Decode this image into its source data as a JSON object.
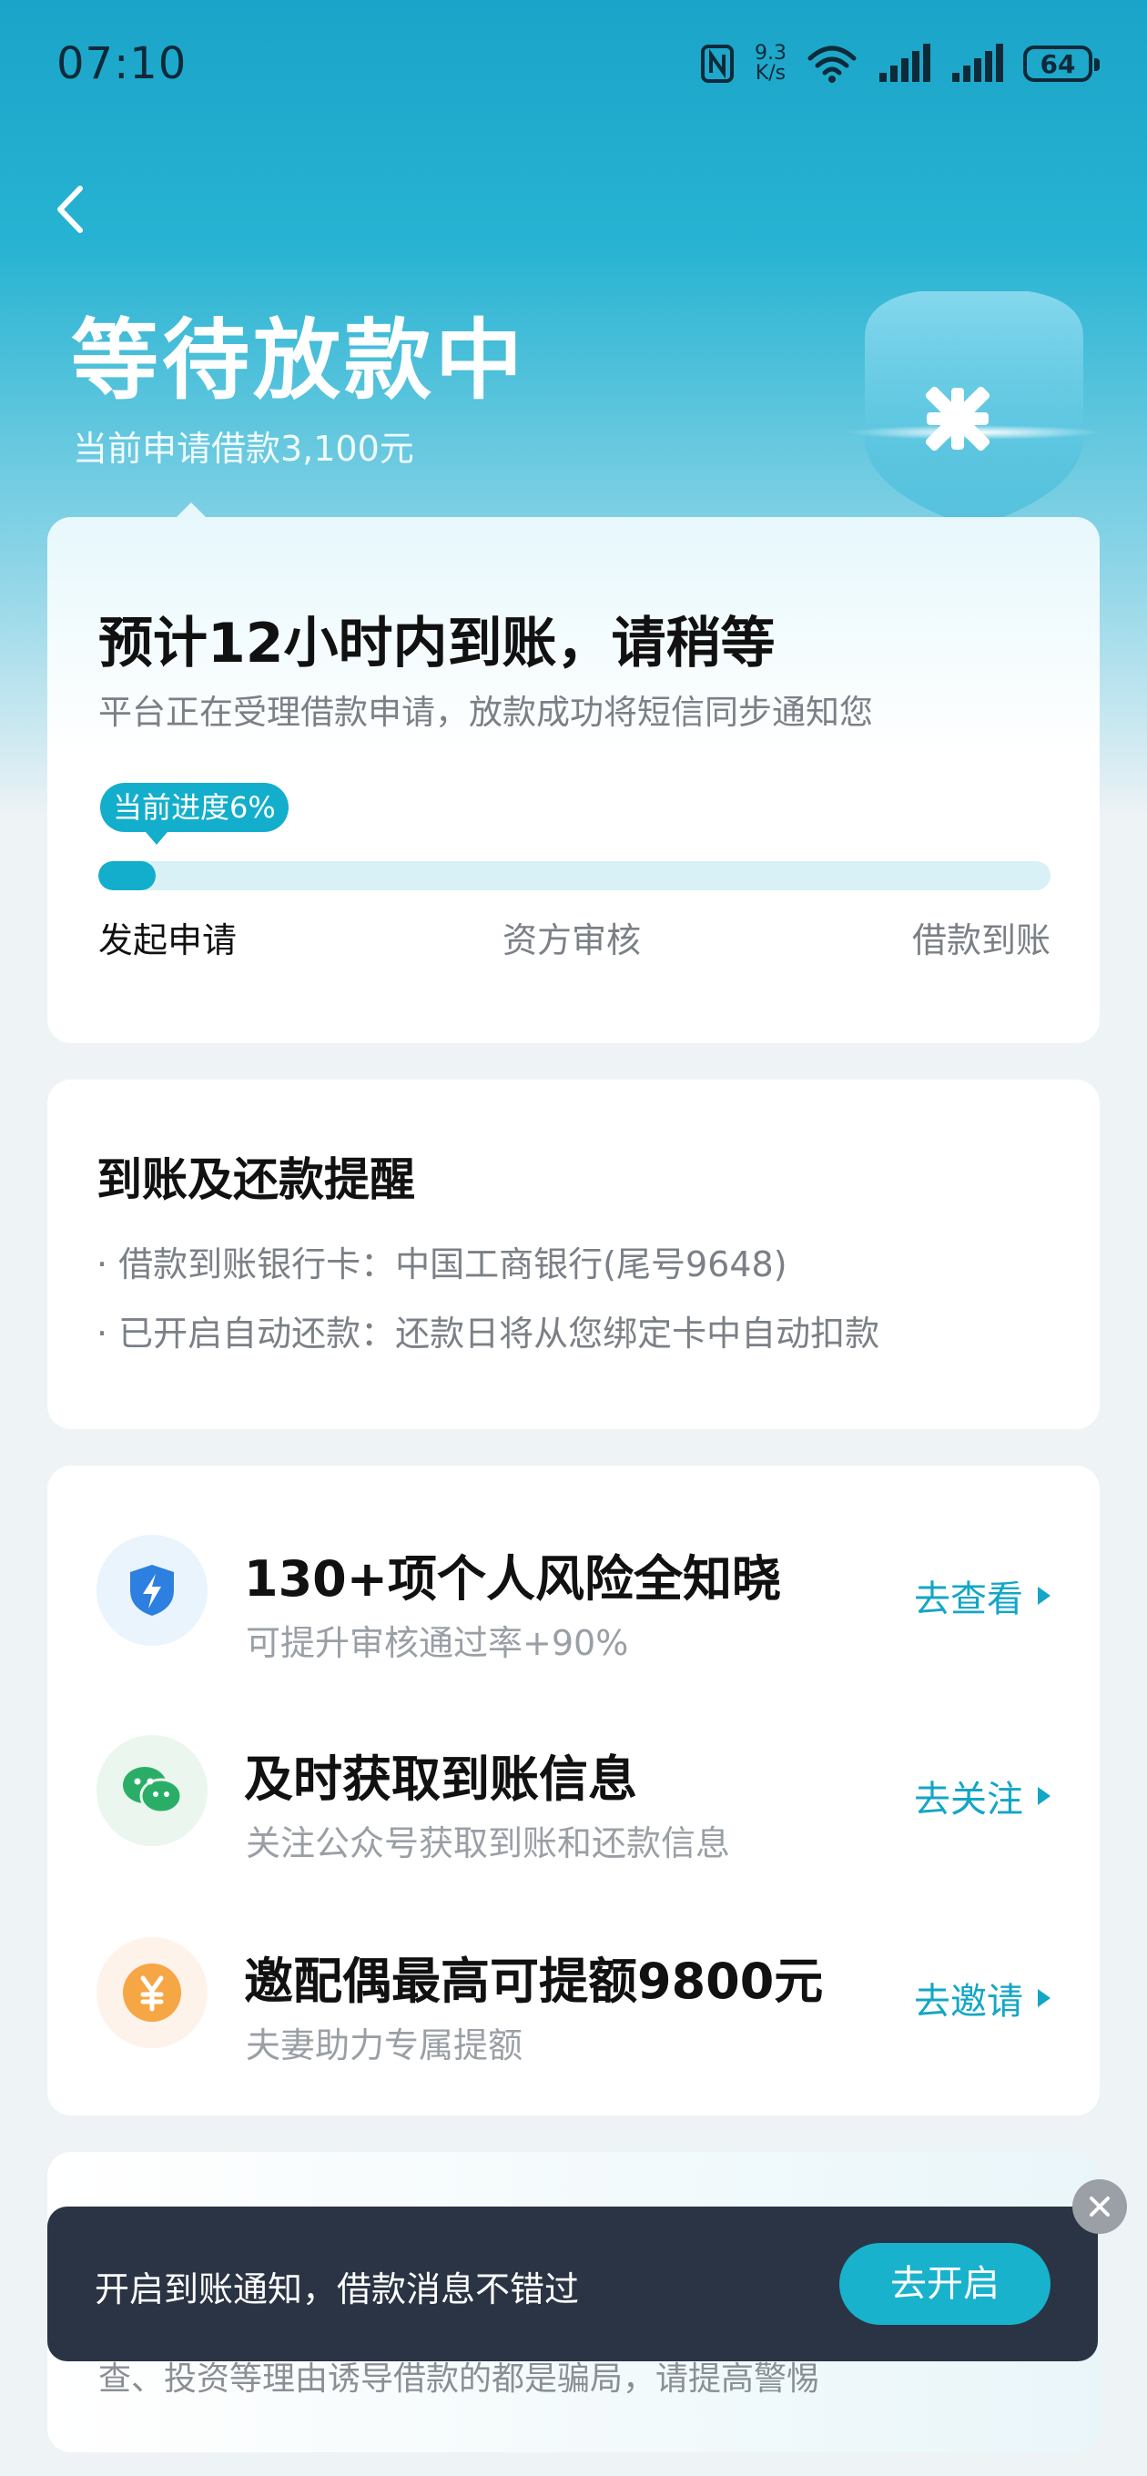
{
  "status_bar": {
    "time": "07:10",
    "net_speed_value": "9.3",
    "net_speed_unit": "K/s",
    "battery": "64",
    "icons": [
      "nfc-icon",
      "wifi-icon",
      "signal-icon",
      "signal-icon"
    ]
  },
  "header": {
    "title": "等待放款中",
    "subtitle": "当前申请借款3,100元"
  },
  "progress_card": {
    "title": "预计12小时内到账，请稍等",
    "description": "平台正在受理借款申请，放款成功将短信同步通知您",
    "badge": "当前进度6%",
    "progress_percent": 6,
    "steps": [
      "发起申请",
      "资方审核",
      "借款到账"
    ]
  },
  "reminder_card": {
    "title": "到账及还款提醒",
    "items": [
      "· 借款到账银行卡：中国工商银行(尾号9648)",
      "· 已开启自动还款：还款日将从您绑定卡中自动扣款"
    ]
  },
  "actions": [
    {
      "title": "130+项个人风险全知晓",
      "subtitle": "可提升审核通过率+90%",
      "link": "去查看",
      "icon": "shield-bolt-icon"
    },
    {
      "title": "及时获取到账信息",
      "subtitle": "关注公众号获取到账和还款信息",
      "link": "去关注",
      "icon": "wechat-icon"
    },
    {
      "title": "邀配偶最高可提额9800元",
      "subtitle": "夫妻助力专属提额",
      "link": "去邀请",
      "icon": "yuan-coin-icon"
    }
  ],
  "notice_card": {
    "text": "查、投资等理由诱导借款的都是骗局，请提高警惕"
  },
  "toast": {
    "text": "开启到账通知，借款消息不错过",
    "button": "去开启"
  },
  "colors": {
    "accent": "#13aecb",
    "link": "#13a6c6",
    "toast_bg": "#2b3444"
  }
}
